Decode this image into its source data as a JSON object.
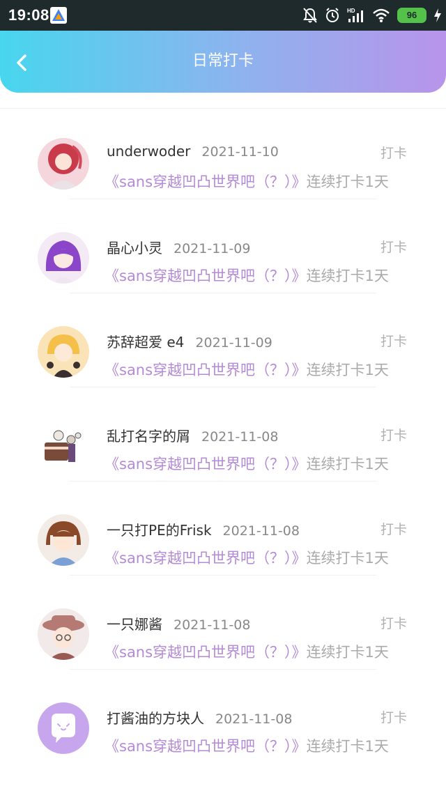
{
  "status_bar": {
    "time": "19:08",
    "battery": "96",
    "icons": [
      "app-logo-icon",
      "mute-bell-icon",
      "alarm-icon",
      "hd-signal-icon",
      "wifi-icon",
      "battery-icon",
      "charging-icon"
    ]
  },
  "header": {
    "title": "日常打卡",
    "back_icon": "chevron-left-icon",
    "gradient_colors": [
      "#48d6ee",
      "#b894ea"
    ]
  },
  "colors": {
    "topic": "#b48ad6",
    "muted": "#aaaaaa"
  },
  "entries": [
    {
      "username": "underwoder",
      "date": "2021-11-10",
      "action": "打卡",
      "topic": "《sans穿越凹凸世界吧（？）》",
      "streak": "连续打卡1天",
      "avatar": "avatar-red-hair"
    },
    {
      "username": "晶心小灵",
      "date": "2021-11-09",
      "action": "打卡",
      "topic": "《sans穿越凹凸世界吧（？）》",
      "streak": "连续打卡1天",
      "avatar": "avatar-purple-hair"
    },
    {
      "username": "苏辞超爱 e4",
      "date": "2021-11-09",
      "action": "打卡",
      "topic": "《sans穿越凹凸世界吧（？）》",
      "streak": "连续打卡1天",
      "avatar": "avatar-blonde"
    },
    {
      "username": "乱打名字的屑",
      "date": "2021-11-08",
      "action": "打卡",
      "topic": "《sans穿越凹凸世界吧（？）》",
      "streak": "连续打卡1天",
      "avatar": "avatar-cake"
    },
    {
      "username": "一只打PE的Frisk",
      "date": "2021-11-08",
      "action": "打卡",
      "topic": "《sans穿越凹凸世界吧（？）》",
      "streak": "连续打卡1天",
      "avatar": "avatar-brown-hair"
    },
    {
      "username": "一只娜酱",
      "date": "2021-11-08",
      "action": "打卡",
      "topic": "《sans穿越凹凸世界吧（？）》",
      "streak": "连续打卡1天",
      "avatar": "avatar-hat-girl"
    },
    {
      "username": "打酱油的方块人",
      "date": "2021-11-08",
      "action": "打卡",
      "topic": "《sans穿越凹凸世界吧（？）》",
      "streak": "连续打卡1天",
      "avatar": "avatar-default-chat"
    }
  ]
}
